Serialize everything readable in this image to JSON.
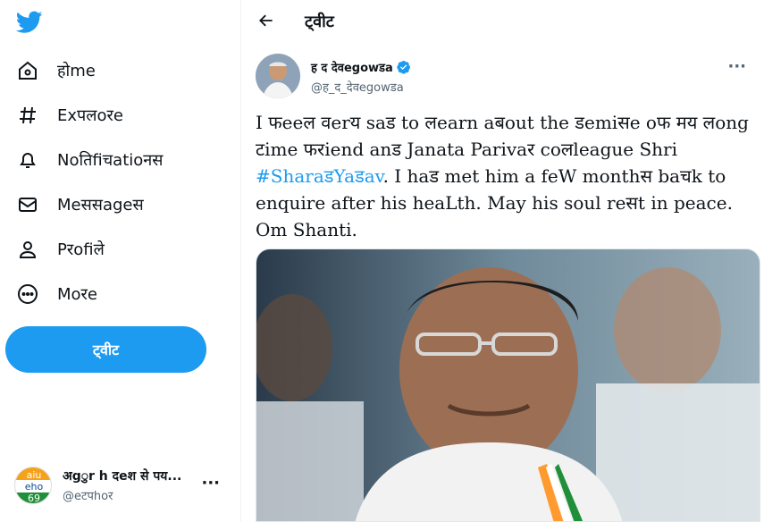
{
  "sidebar": {
    "items": [
      {
        "label": "होme",
        "icon": "home-icon"
      },
      {
        "label": "Exपलoरe",
        "icon": "hashtag-icon"
      },
      {
        "label": "Noतिfiचatioनस",
        "icon": "bell-icon"
      },
      {
        "label": "Meससageस",
        "icon": "mail-icon"
      },
      {
        "label": "Pरofiले",
        "icon": "person-icon"
      },
      {
        "label": "Moरe",
        "icon": "more-circle-icon"
      }
    ],
    "tweet_button": "ट्वीट"
  },
  "account": {
    "name": "अgुr h दeश से पय...",
    "handle": "@eटपhoर",
    "avatar_text": "aiu eho 69"
  },
  "header": {
    "title": "ट्वीट"
  },
  "tweet": {
    "author_name": "ह द देवegowडa",
    "author_handle": "@ह_द_देवegowडa",
    "text_before": "I फeeल वerय saड tο लearn aबout the डemiसe oफ मय लong टime फरiend anड Janata Parivaर coलleague Shri ",
    "hashtag": "#SharaडYaडav",
    "text_after": ". I haड met him a feW monthस baचk to enquire after his heaLth. May his soul reसt in peace. Om Shanti."
  },
  "colors": {
    "accent": "#1d9bf0",
    "text": "#0f1419",
    "secondary": "#536471"
  }
}
